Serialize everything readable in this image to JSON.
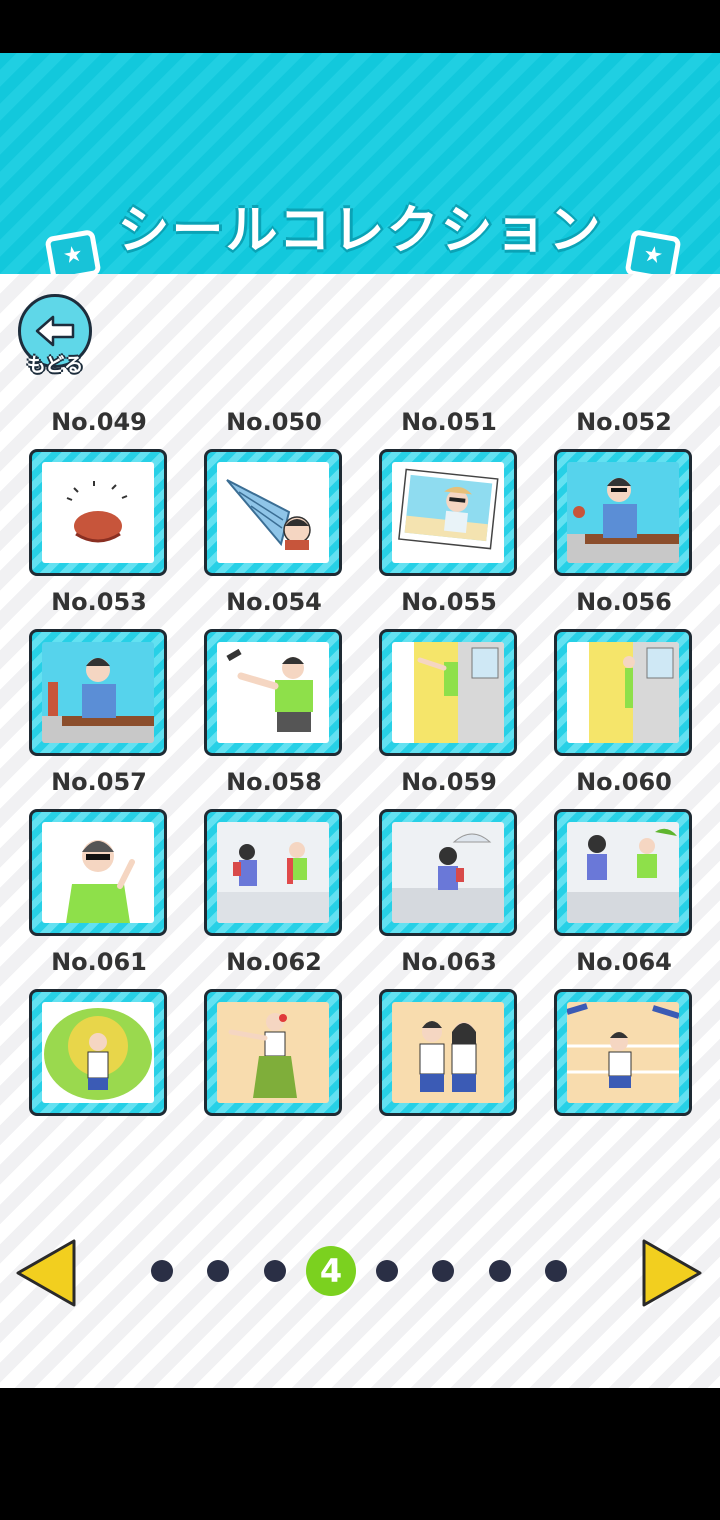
{
  "header": {
    "title": "シールコレクション",
    "icons": [
      "sticker-icon",
      "sticker-icon"
    ]
  },
  "back_button": {
    "label": "もどる",
    "icon": "left-arrow-icon"
  },
  "stickers": [
    {
      "number": "No.049",
      "scene": "crab"
    },
    {
      "number": "No.050",
      "scene": "hermit-crab-shell"
    },
    {
      "number": "No.051",
      "scene": "beach-photo"
    },
    {
      "number": "No.052",
      "scene": "boy-sunglasses-window"
    },
    {
      "number": "No.053",
      "scene": "boy-phone-window"
    },
    {
      "number": "No.054",
      "scene": "boy-throwing-phone"
    },
    {
      "number": "No.055",
      "scene": "door-yellow-wall"
    },
    {
      "number": "No.056",
      "scene": "door-yellow-wall-peek"
    },
    {
      "number": "No.057",
      "scene": "boy-sunglasses-green-shirt"
    },
    {
      "number": "No.058",
      "scene": "boy-girl-street"
    },
    {
      "number": "No.059",
      "scene": "girl-umbrella-rain"
    },
    {
      "number": "No.060",
      "scene": "boy-girl-rain"
    },
    {
      "number": "No.061",
      "scene": "carnival-feathers"
    },
    {
      "number": "No.062",
      "scene": "hula-dancer"
    },
    {
      "number": "No.063",
      "scene": "boy-girl-couple"
    },
    {
      "number": "No.064",
      "scene": "boy-running"
    }
  ],
  "pager": {
    "current_page": "4",
    "total_pages": 8,
    "prev_icon": "left-triangle-icon",
    "next_icon": "right-triangle-icon"
  },
  "colors": {
    "header": "#20cfe2",
    "frame": "#27d0e6",
    "active_dot": "#7bd11f",
    "inactive_dot": "#2a2f45",
    "arrow": "#f2cf1f"
  }
}
